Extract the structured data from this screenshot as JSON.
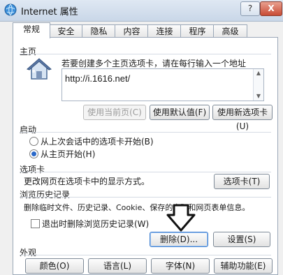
{
  "window": {
    "title": "Internet 属性",
    "help": "?",
    "close": "X"
  },
  "tabs": [
    "常规",
    "安全",
    "隐私",
    "内容",
    "连接",
    "程序",
    "高级"
  ],
  "home": {
    "section": "主页",
    "description": "若要创建多个主页选项卡，请在每行输入一个地址",
    "url": "http://i.1616.net/",
    "buttons": {
      "current": "使用当前页(C)",
      "default": "使用默认值(F)",
      "blank": "使用新选项卡(U)"
    }
  },
  "startup": {
    "section": "启动",
    "option1": "从上次会话中的选项卡开始(B)",
    "option2": "从主页开始(H)",
    "selected": "从主页开始(H)"
  },
  "tabs_section": {
    "section": "选项卡",
    "description": "更改网页在选项卡中的显示方式。",
    "button": "选项卡(T)"
  },
  "history": {
    "section": "浏览历史记录",
    "description": "删除临时文件、历史记录、Cookie、保存的密码和网页表单信息。",
    "checkbox": "退出时删除浏览历史记录(W)",
    "delete": "删除(D)...",
    "settings": "设置(S)"
  },
  "appearance": {
    "section": "外观",
    "buttons": [
      "颜色(O)",
      "语言(L)",
      "字体(N)",
      "辅助功能(E)"
    ]
  },
  "icons": {
    "title": "globe-icon",
    "home": "house-icon",
    "arrow": "down-arrow-icon"
  }
}
